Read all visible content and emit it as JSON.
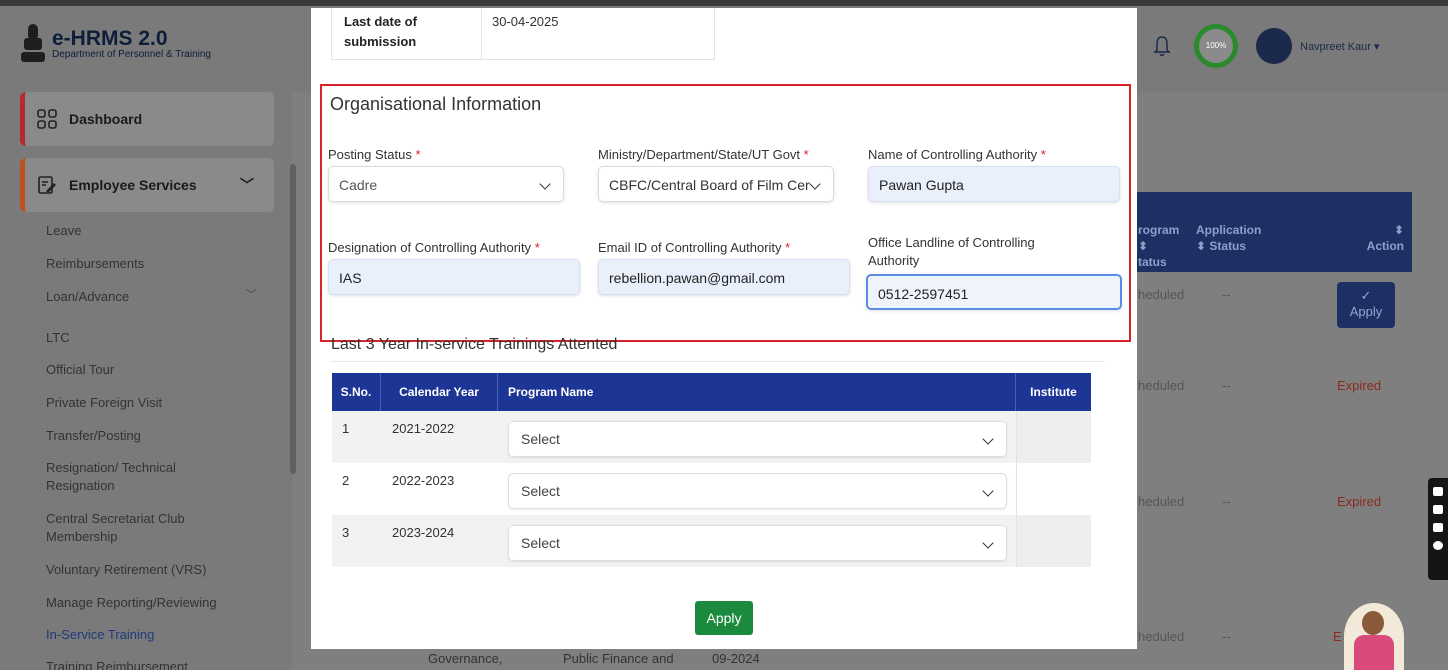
{
  "app": {
    "title": "e-HRMS 2.0",
    "subtitle": "Department of Personnel & Training"
  },
  "header": {
    "progress_label": "100%",
    "progress": 1.0,
    "user_name": "Navpreet Kaur ▾"
  },
  "sidebar": {
    "dashboard": "Dashboard",
    "employee_services": "Employee Services",
    "items": [
      "Leave",
      "Reimbursements",
      "Loan/Advance",
      "LTC",
      "Official Tour",
      "Private Foreign Visit",
      "Transfer/Posting",
      "Resignation/ Technical Resignation",
      "Central Secretariat Club Membership",
      "Voluntary Retirement (VRS)",
      "Manage Reporting/Reviewing",
      "In-Service Training",
      "Training Reimbursement"
    ]
  },
  "background_table": {
    "headers": [
      "rogram ⬍ tatus",
      "Application ⬍ Status",
      "⬍ Action"
    ],
    "rows": [
      {
        "status": "heduled",
        "app_status": "--",
        "action": "Apply"
      },
      {
        "status": "heduled",
        "app_status": "--",
        "action": "Expired"
      },
      {
        "status": "heduled",
        "app_status": "--",
        "action": "Expired"
      },
      {
        "status": "heduled",
        "app_status": "--",
        "action": "E"
      }
    ],
    "bottom_cells": [
      "Governance,",
      "Public Finance and",
      "09-2024"
    ]
  },
  "modal": {
    "last_date_label": "Last date of submission",
    "last_date_value": "30-04-2025",
    "org": {
      "title": "Organisational Information",
      "posting_status_label": "Posting Status",
      "posting_status_value": "Cadre",
      "ministry_label": "Ministry/Department/State/UT Govt",
      "ministry_value": "CBFC/Central Board of Film Cer",
      "controlling_name_label": "Name of Controlling Authority",
      "controlling_name_value": "Pawan Gupta",
      "designation_label": "Designation of Controlling Authority",
      "designation_value": "IAS",
      "email_label": "Email ID of Controlling Authority",
      "email_value": "rebellion.pawan@gmail.com",
      "landline_label": "Office Landline of Controlling Authority",
      "landline_value": "0512-2597451",
      "required_mark": "*"
    },
    "trainings": {
      "heading": "Last 3 Year In-service Trainings Attented",
      "columns": [
        "S.No.",
        "Calendar Year",
        "Program Name",
        "Institute"
      ],
      "rows": [
        {
          "sno": "1",
          "year": "2021-2022",
          "program": "Select"
        },
        {
          "sno": "2",
          "year": "2022-2023",
          "program": "Select"
        },
        {
          "sno": "3",
          "year": "2023-2024",
          "program": "Select"
        }
      ]
    },
    "apply_label": "Apply"
  }
}
